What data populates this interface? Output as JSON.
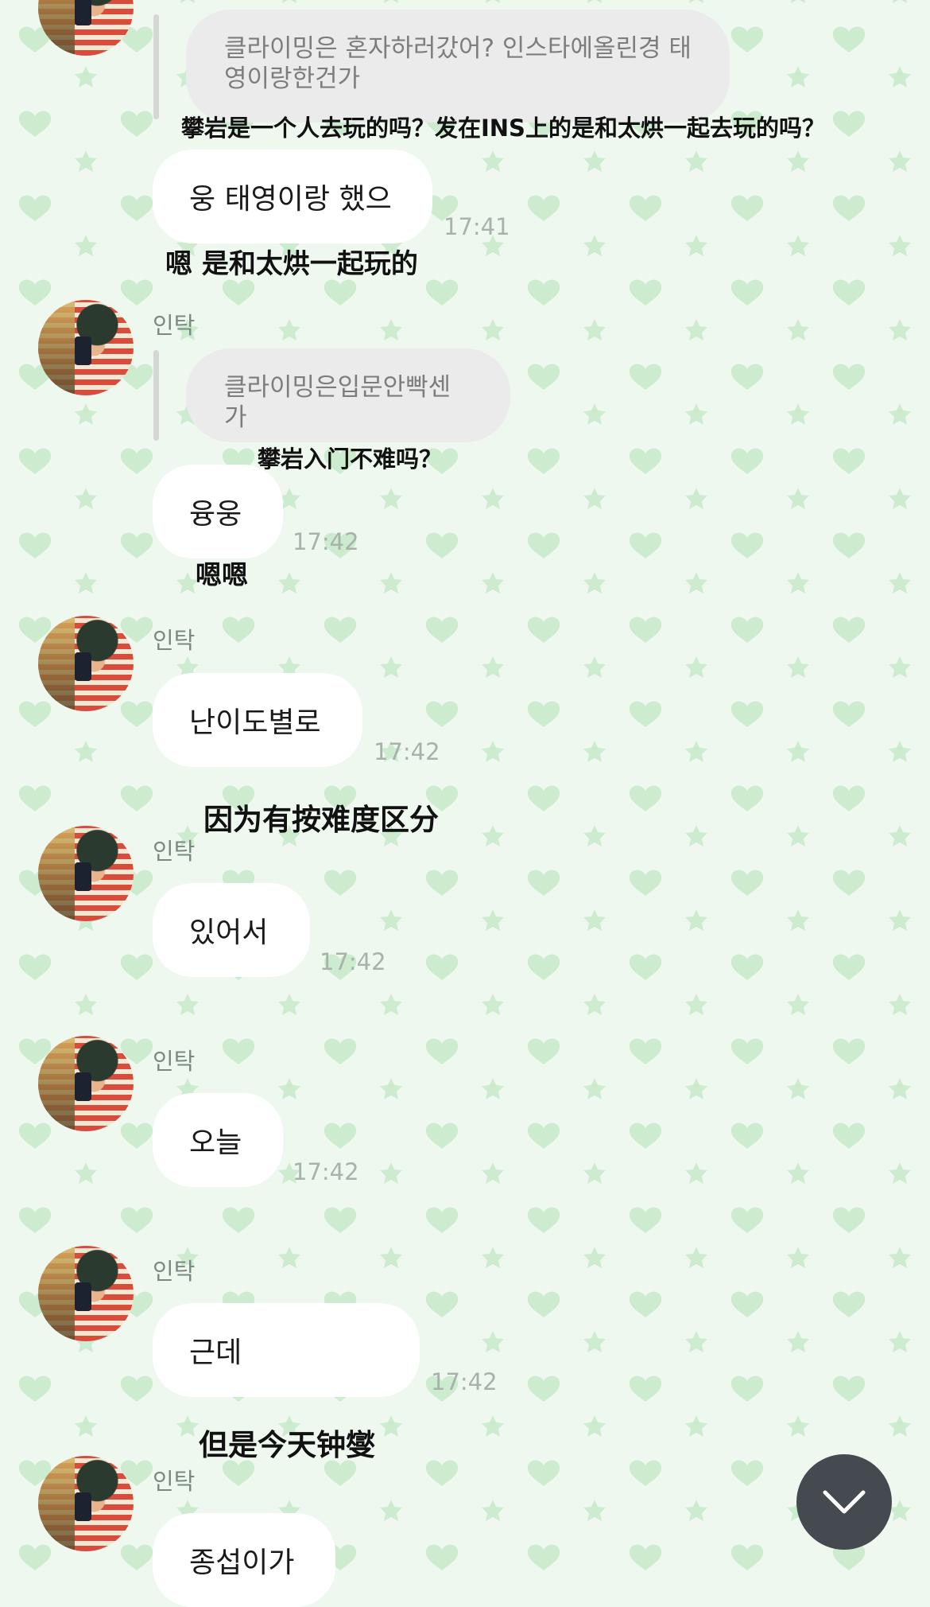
{
  "colors": {
    "background": "#eef8ef",
    "pattern": "#cfeed3",
    "bubble": "#ffffff",
    "quote_bubble": "#ebebeb",
    "timestamp": "#a6b2aa",
    "scroll_button": "#454a51"
  },
  "messages": [
    {
      "quote": "클라이밍은 혼자하러갔어? 인스타에올린경 태영이랑한건가",
      "quote_caption": "攀岩是一个人去玩的吗？发在INS上的是和太烘一起去玩的吗？",
      "text": "웅 태영이랑 했으",
      "time": "17:41",
      "caption": "嗯 是和太烘一起玩的"
    },
    {
      "sender": "인탁",
      "quote": "클라이밍은입문안빡센가",
      "quote_caption": "攀岩入门不难吗？",
      "text": "융웅",
      "time": "17:42",
      "caption": "嗯嗯"
    },
    {
      "sender": "인탁",
      "text": "난이도별로",
      "time": "17:42",
      "caption": "因为有按难度区分"
    },
    {
      "sender": "인탁",
      "text": "있어서",
      "time": "17:42"
    },
    {
      "sender": "인탁",
      "text": "오늘",
      "time": "17:42"
    },
    {
      "sender": "인탁",
      "text": "근데",
      "time": "17:42",
      "caption": "但是今天钟燮"
    },
    {
      "sender": "인탁",
      "text": "종섭이가"
    }
  ],
  "icons": {
    "scroll_down": "chevron-down-icon",
    "avatar": "profile-photo"
  }
}
